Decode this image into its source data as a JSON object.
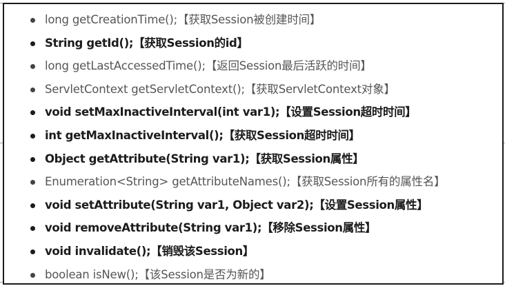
{
  "methods": [
    {
      "text": "long getCreationTime();【获取Session被创建时间】",
      "bold": false
    },
    {
      "text": "String getId();【获取Session的id】",
      "bold": true
    },
    {
      "text": "long getLastAccessedTime();【返回Session最后活跃的时间】",
      "bold": false
    },
    {
      "text": "ServletContext getServletContext();【获取ServletContext对象】",
      "bold": false
    },
    {
      "text": "void setMaxInactiveInterval(int var1);【设置Session超时时间】",
      "bold": true
    },
    {
      "text": "int getMaxInactiveInterval();【获取Session超时时间】",
      "bold": true
    },
    {
      "text": "Object getAttribute(String var1);【获取Session属性】",
      "bold": true
    },
    {
      "text": "Enumeration<String> getAttributeNames();【获取Session所有的属性名】",
      "bold": false
    },
    {
      "text": "void setAttribute(String var1, Object var2);【设置Session属性】",
      "bold": true
    },
    {
      "text": "void removeAttribute(String var1);【移除Session属性】",
      "bold": true
    },
    {
      "text": "void invalidate();【销毁该Session】",
      "bold": true
    },
    {
      "text": "boolean isNew();【该Session是否为新的】",
      "bold": false
    }
  ]
}
